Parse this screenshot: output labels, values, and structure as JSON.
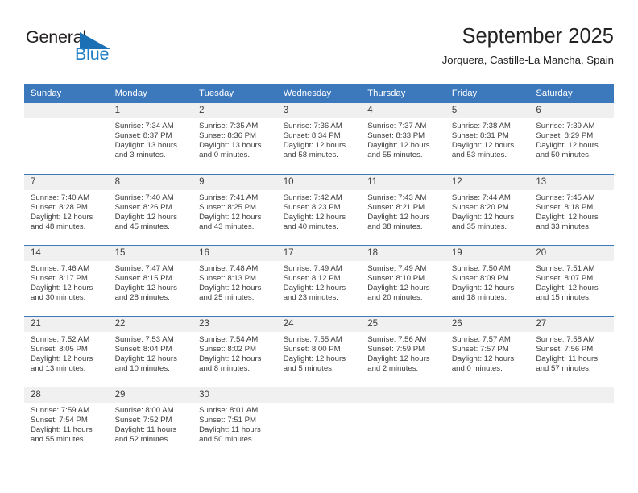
{
  "logo": {
    "word1": "General",
    "word2": "Blue",
    "triangle_color": "#1b6fb5",
    "word1_color": "#231f20",
    "word2_color": "#1f7fc4"
  },
  "header": {
    "title": "September 2025",
    "subtitle": "Jorquera, Castille-La Mancha, Spain"
  },
  "theme": {
    "header_bg": "#3c78bc",
    "daynum_bg": "#f0f0f0",
    "text": "#3c3c3c"
  },
  "calendar": {
    "weekday_headers": [
      "Sunday",
      "Monday",
      "Tuesday",
      "Wednesday",
      "Thursday",
      "Friday",
      "Saturday"
    ],
    "weeks": [
      [
        {
          "day": "",
          "lines": []
        },
        {
          "day": "1",
          "lines": [
            "Sunrise: 7:34 AM",
            "Sunset: 8:37 PM",
            "Daylight: 13 hours",
            "and 3 minutes."
          ]
        },
        {
          "day": "2",
          "lines": [
            "Sunrise: 7:35 AM",
            "Sunset: 8:36 PM",
            "Daylight: 13 hours",
            "and 0 minutes."
          ]
        },
        {
          "day": "3",
          "lines": [
            "Sunrise: 7:36 AM",
            "Sunset: 8:34 PM",
            "Daylight: 12 hours",
            "and 58 minutes."
          ]
        },
        {
          "day": "4",
          "lines": [
            "Sunrise: 7:37 AM",
            "Sunset: 8:33 PM",
            "Daylight: 12 hours",
            "and 55 minutes."
          ]
        },
        {
          "day": "5",
          "lines": [
            "Sunrise: 7:38 AM",
            "Sunset: 8:31 PM",
            "Daylight: 12 hours",
            "and 53 minutes."
          ]
        },
        {
          "day": "6",
          "lines": [
            "Sunrise: 7:39 AM",
            "Sunset: 8:29 PM",
            "Daylight: 12 hours",
            "and 50 minutes."
          ]
        }
      ],
      [
        {
          "day": "7",
          "lines": [
            "Sunrise: 7:40 AM",
            "Sunset: 8:28 PM",
            "Daylight: 12 hours",
            "and 48 minutes."
          ]
        },
        {
          "day": "8",
          "lines": [
            "Sunrise: 7:40 AM",
            "Sunset: 8:26 PM",
            "Daylight: 12 hours",
            "and 45 minutes."
          ]
        },
        {
          "day": "9",
          "lines": [
            "Sunrise: 7:41 AM",
            "Sunset: 8:25 PM",
            "Daylight: 12 hours",
            "and 43 minutes."
          ]
        },
        {
          "day": "10",
          "lines": [
            "Sunrise: 7:42 AM",
            "Sunset: 8:23 PM",
            "Daylight: 12 hours",
            "and 40 minutes."
          ]
        },
        {
          "day": "11",
          "lines": [
            "Sunrise: 7:43 AM",
            "Sunset: 8:21 PM",
            "Daylight: 12 hours",
            "and 38 minutes."
          ]
        },
        {
          "day": "12",
          "lines": [
            "Sunrise: 7:44 AM",
            "Sunset: 8:20 PM",
            "Daylight: 12 hours",
            "and 35 minutes."
          ]
        },
        {
          "day": "13",
          "lines": [
            "Sunrise: 7:45 AM",
            "Sunset: 8:18 PM",
            "Daylight: 12 hours",
            "and 33 minutes."
          ]
        }
      ],
      [
        {
          "day": "14",
          "lines": [
            "Sunrise: 7:46 AM",
            "Sunset: 8:17 PM",
            "Daylight: 12 hours",
            "and 30 minutes."
          ]
        },
        {
          "day": "15",
          "lines": [
            "Sunrise: 7:47 AM",
            "Sunset: 8:15 PM",
            "Daylight: 12 hours",
            "and 28 minutes."
          ]
        },
        {
          "day": "16",
          "lines": [
            "Sunrise: 7:48 AM",
            "Sunset: 8:13 PM",
            "Daylight: 12 hours",
            "and 25 minutes."
          ]
        },
        {
          "day": "17",
          "lines": [
            "Sunrise: 7:49 AM",
            "Sunset: 8:12 PM",
            "Daylight: 12 hours",
            "and 23 minutes."
          ]
        },
        {
          "day": "18",
          "lines": [
            "Sunrise: 7:49 AM",
            "Sunset: 8:10 PM",
            "Daylight: 12 hours",
            "and 20 minutes."
          ]
        },
        {
          "day": "19",
          "lines": [
            "Sunrise: 7:50 AM",
            "Sunset: 8:09 PM",
            "Daylight: 12 hours",
            "and 18 minutes."
          ]
        },
        {
          "day": "20",
          "lines": [
            "Sunrise: 7:51 AM",
            "Sunset: 8:07 PM",
            "Daylight: 12 hours",
            "and 15 minutes."
          ]
        }
      ],
      [
        {
          "day": "21",
          "lines": [
            "Sunrise: 7:52 AM",
            "Sunset: 8:05 PM",
            "Daylight: 12 hours",
            "and 13 minutes."
          ]
        },
        {
          "day": "22",
          "lines": [
            "Sunrise: 7:53 AM",
            "Sunset: 8:04 PM",
            "Daylight: 12 hours",
            "and 10 minutes."
          ]
        },
        {
          "day": "23",
          "lines": [
            "Sunrise: 7:54 AM",
            "Sunset: 8:02 PM",
            "Daylight: 12 hours",
            "and 8 minutes."
          ]
        },
        {
          "day": "24",
          "lines": [
            "Sunrise: 7:55 AM",
            "Sunset: 8:00 PM",
            "Daylight: 12 hours",
            "and 5 minutes."
          ]
        },
        {
          "day": "25",
          "lines": [
            "Sunrise: 7:56 AM",
            "Sunset: 7:59 PM",
            "Daylight: 12 hours",
            "and 2 minutes."
          ]
        },
        {
          "day": "26",
          "lines": [
            "Sunrise: 7:57 AM",
            "Sunset: 7:57 PM",
            "Daylight: 12 hours",
            "and 0 minutes."
          ]
        },
        {
          "day": "27",
          "lines": [
            "Sunrise: 7:58 AM",
            "Sunset: 7:56 PM",
            "Daylight: 11 hours",
            "and 57 minutes."
          ]
        }
      ],
      [
        {
          "day": "28",
          "lines": [
            "Sunrise: 7:59 AM",
            "Sunset: 7:54 PM",
            "Daylight: 11 hours",
            "and 55 minutes."
          ]
        },
        {
          "day": "29",
          "lines": [
            "Sunrise: 8:00 AM",
            "Sunset: 7:52 PM",
            "Daylight: 11 hours",
            "and 52 minutes."
          ]
        },
        {
          "day": "30",
          "lines": [
            "Sunrise: 8:01 AM",
            "Sunset: 7:51 PM",
            "Daylight: 11 hours",
            "and 50 minutes."
          ]
        },
        {
          "day": "",
          "lines": []
        },
        {
          "day": "",
          "lines": []
        },
        {
          "day": "",
          "lines": []
        },
        {
          "day": "",
          "lines": []
        }
      ]
    ]
  }
}
